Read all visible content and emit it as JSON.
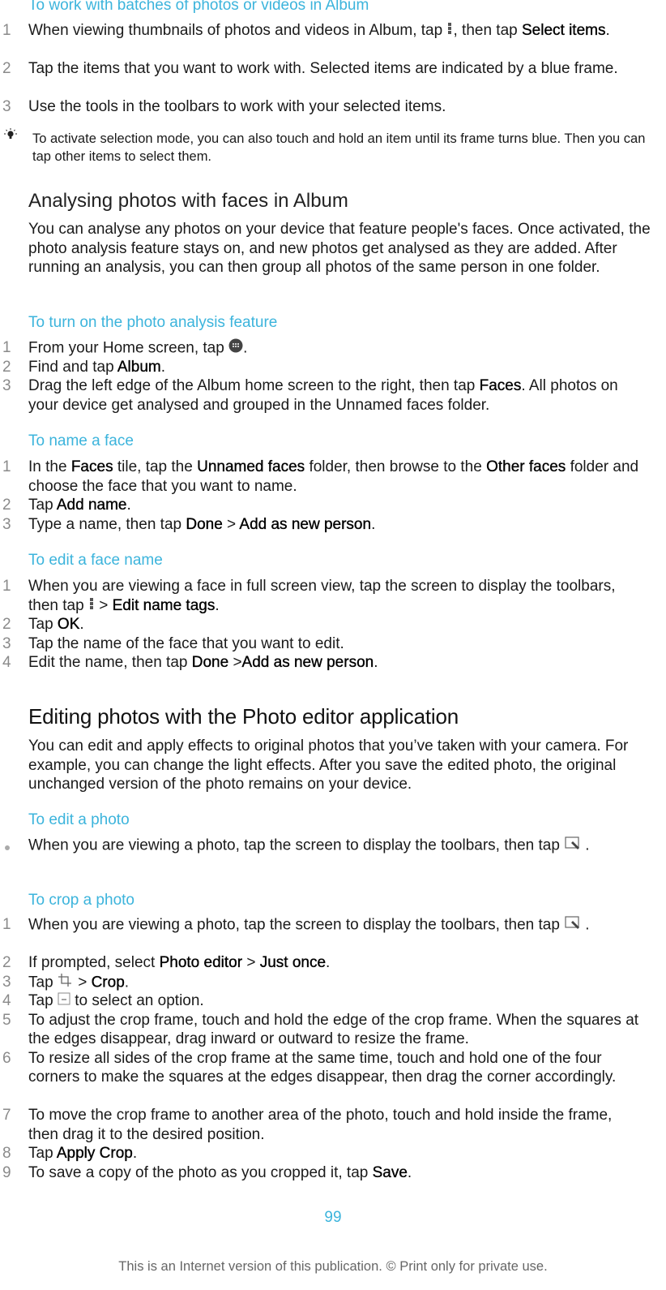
{
  "colors": {
    "accent": "#3cb4dc",
    "text": "#1a1a1a",
    "step_number": "#8a8a8a",
    "footer": "#666666"
  },
  "batches": {
    "title": "To work with batches of photos or videos in Album",
    "steps": [
      {
        "num": "1",
        "parts": [
          "When viewing thumbnails of photos and videos in Album, tap ",
          "{menu-dots-icon}",
          ", then tap ",
          "*Select items",
          "."
        ]
      },
      {
        "num": "2",
        "parts": [
          "Tap the items that you want to work with. Selected items are indicated by a blue frame."
        ]
      },
      {
        "num": "3",
        "parts": [
          "Use the tools in the toolbars to work with your selected items."
        ]
      }
    ],
    "tip": {
      "icon": "lightbulb-icon",
      "text": "To activate selection mode, you can also touch and hold an item until its frame turns blue. Then you can tap other items to select them."
    }
  },
  "faces": {
    "heading": "Analysing photos with faces in Album",
    "intro": "You can analyse any photos on your device that feature people's faces. Once activated, the photo analysis feature stays on, and new photos get analysed as they are added. After running an analysis, you can then group all photos of the same person in one folder.",
    "turn_on": {
      "title": "To turn on the photo analysis feature",
      "steps": [
        {
          "num": "1",
          "parts": [
            "From your Home screen, tap ",
            "{apps-grid-icon}",
            "."
          ]
        },
        {
          "num": "2",
          "parts": [
            "Find and tap ",
            "*Album",
            "."
          ]
        },
        {
          "num": "3",
          "parts": [
            "Drag the left edge of the Album home screen to the right, then tap ",
            "*Faces",
            ". All photos on your device get analysed and grouped in the Unnamed faces folder."
          ]
        }
      ]
    },
    "name_face": {
      "title": "To name a face",
      "steps": [
        {
          "num": "1",
          "parts": [
            "In the ",
            "*Faces",
            " tile, tap the ",
            "*Unnamed faces",
            " folder, then browse to the ",
            "*Other faces",
            " folder and choose the face that you want to name."
          ]
        },
        {
          "num": "2",
          "parts": [
            "Tap ",
            "*Add name",
            "."
          ]
        },
        {
          "num": "3",
          "parts": [
            "Type a name, then tap ",
            "*Done",
            " > ",
            "*Add as new person",
            "."
          ]
        }
      ]
    },
    "edit_face": {
      "title": "To edit a face name",
      "steps": [
        {
          "num": "1",
          "parts": [
            "When you are viewing a face in full screen view, tap the screen to display the toolbars, then tap ",
            "{menu-dots-icon}",
            " > ",
            "*Edit name tags",
            "."
          ]
        },
        {
          "num": "2",
          "parts": [
            "Tap ",
            "*OK",
            "."
          ]
        },
        {
          "num": "3",
          "parts": [
            "Tap the name of the face that you want to edit."
          ]
        },
        {
          "num": "4",
          "parts": [
            "Edit the name, then tap ",
            "*Done",
            " >",
            "*Add as new person",
            "."
          ]
        }
      ]
    }
  },
  "editor": {
    "heading": "Editing photos with the Photo editor application",
    "intro": "You can edit and apply effects to original photos that you’ve taken with your camera. For example, you can change the light effects. After you save the edited photo, the original unchanged version of the photo remains on your device.",
    "edit_photo": {
      "title": "To edit a photo",
      "bullet": [
        "When you are viewing a photo, tap the screen to display the toolbars, then tap ",
        "{edit-photo-icon}",
        "."
      ]
    },
    "crop_photo": {
      "title": "To crop a photo",
      "steps": [
        {
          "num": "1",
          "parts": [
            "When you are viewing a photo, tap the screen to display the toolbars, then tap ",
            "{edit-photo-icon}",
            "."
          ]
        },
        {
          "num": "2",
          "parts": [
            "If prompted, select ",
            "*Photo editor",
            " > ",
            "*Just once",
            "."
          ]
        },
        {
          "num": "3",
          "parts": [
            "Tap ",
            "{crop-icon}",
            " > ",
            "*Crop",
            "."
          ]
        },
        {
          "num": "4",
          "parts": [
            "Tap ",
            "{dropdown-box-icon}",
            " to select an option."
          ]
        },
        {
          "num": "5",
          "parts": [
            "To adjust the crop frame, touch and hold the edge of the crop frame. When the squares at the edges disappear, drag inward or outward to resize the frame."
          ]
        },
        {
          "num": "6",
          "parts": [
            "To resize all sides of the crop frame at the same time, touch and hold one of the four corners to make the squares at the edges disappear, then drag the corner accordingly."
          ]
        },
        {
          "num": "7",
          "parts": [
            "To move the crop frame to another area of the photo, touch and hold inside the frame, then drag it to the desired position."
          ]
        },
        {
          "num": "8",
          "parts": [
            "Tap ",
            "*Apply Crop",
            "."
          ]
        },
        {
          "num": "9",
          "parts": [
            "To save a copy of the photo as you cropped it, tap ",
            "*Save",
            "."
          ]
        }
      ]
    }
  },
  "page_number": "99",
  "footer": "This is an Internet version of this publication. © Print only for private use."
}
